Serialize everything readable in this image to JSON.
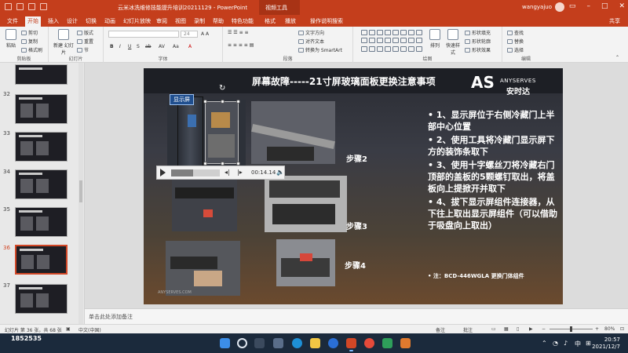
{
  "app": {
    "document_title": "云米冰洗维修技能提升培训20211129 - PowerPoint",
    "context_tab": "视频工具",
    "user": "wangyajuo",
    "share": "共享"
  },
  "tabs": [
    "文件",
    "开始",
    "插入",
    "设计",
    "切换",
    "动画",
    "幻灯片放映",
    "审阅",
    "视图",
    "录制",
    "帮助",
    "特色功能",
    "格式",
    "播放",
    "操作说明搜索"
  ],
  "active_tab": "开始",
  "ribbon": {
    "clipboard": {
      "paste": "粘贴",
      "cut": "剪切",
      "copy": "复制",
      "format_painter": "格式刷",
      "label": "剪贴板"
    },
    "slides": {
      "new_slide": "新建\n幻灯片",
      "layout": "版式",
      "reset": "重置",
      "section": "节",
      "label": "幻灯片"
    },
    "font": {
      "label": "字体",
      "size": "24"
    },
    "paragraph": {
      "text_direction": "文字方向",
      "align_text": "对齐文本",
      "smartart": "转换为 SmartArt",
      "label": "段落"
    },
    "drawing": {
      "arrange": "排列",
      "quick_styles": "快速样式",
      "fill": "形状填充",
      "outline": "形状轮廓",
      "effects": "形状效果",
      "label": "绘图"
    },
    "editing": {
      "find": "查找",
      "replace": "替换",
      "select": "选择",
      "label": "编辑"
    }
  },
  "thumbnails": [
    {
      "num": "",
      "active": false
    },
    {
      "num": "32",
      "active": false
    },
    {
      "num": "33",
      "active": false
    },
    {
      "num": "34",
      "active": false
    },
    {
      "num": "35",
      "active": false
    },
    {
      "num": "36",
      "active": true
    },
    {
      "num": "37",
      "active": false
    }
  ],
  "slide": {
    "title": "屏幕故障-----21寸屏玻璃面板更换注意事项",
    "logo_letters": "AS",
    "logo_en": "ANYSERVES",
    "logo_cn": "安时达",
    "display_label": "显示屏",
    "steps": [
      "步骤2",
      "步骤3",
      "步骤4"
    ],
    "bullets": [
      "• 1、显示屏位于右侧冷藏门上半部中心位置",
      "• 2、使用工具将冷藏门显示屏下方的装饰条取下",
      "• 3、使用十字螺丝刀将冷藏右门顶部的盖板的5颗螺钉取出，将盖板向上提掀开并取下",
      "• 4、拔下显示屏组件连接器，从下往上取出显示屏组件（可以借助于吸盘向上取出）"
    ],
    "note": "• 注：BCD-446WGLA 更换门体组件",
    "photo_caption": "ANYSERVES.COM"
  },
  "player": {
    "time": "00:14.14",
    "progress": 0.45
  },
  "notes_placeholder": "单击此处添加备注",
  "status": {
    "slide_info": "幻灯片 第 36 张，共 68 张",
    "language": "中文(中国)",
    "notes_btn": "备注",
    "comments_btn": "批注",
    "zoom": "80%"
  },
  "taskbar": {
    "watermark": "1852535",
    "time": "20:57",
    "date": "2021/12/7"
  }
}
